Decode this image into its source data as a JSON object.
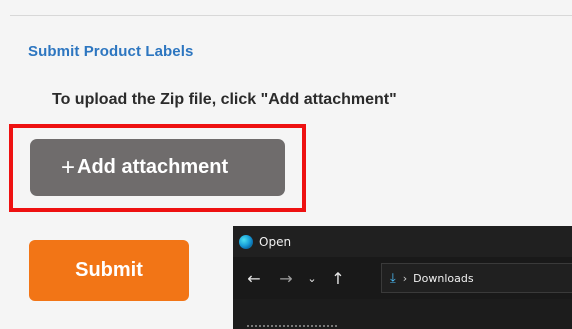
{
  "form": {
    "section_title": "Submit Product Labels",
    "instructions": "To upload the Zip file, click \"Add attachment\"",
    "add_attachment_label": "Add attachment",
    "add_attachment_icon": "plus-icon",
    "submit_label": "Submit"
  },
  "dialog": {
    "title": "Open",
    "nav": {
      "back_icon": "←",
      "forward_icon": "→",
      "recent_icon": "⌄",
      "up_icon": "↑"
    },
    "address": {
      "folder": "Downloads"
    }
  },
  "colors": {
    "link_blue": "#2d76c0",
    "highlight_red": "#ee1111",
    "button_gray": "#6f6c6c",
    "submit_orange": "#f27516",
    "dialog_bg": "#202020"
  }
}
